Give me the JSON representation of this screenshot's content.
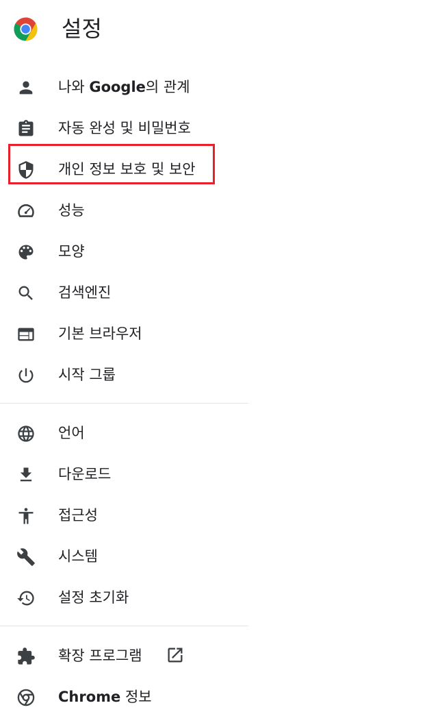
{
  "header": {
    "title": "설정",
    "logo_icon": "chrome-logo-icon"
  },
  "menu": {
    "group1": [
      {
        "id": "you-and-google",
        "icon": "person-icon",
        "label_prefix": "나와 ",
        "label_bold": "Google",
        "label_suffix": "의 관계"
      },
      {
        "id": "autofill",
        "icon": "clipboard-icon",
        "label": "자동 완성 및 비밀번호"
      },
      {
        "id": "privacy",
        "icon": "shield-icon",
        "label": "개인 정보 보호 및 보안",
        "highlighted": true
      },
      {
        "id": "performance",
        "icon": "speedometer-icon",
        "label": "성능"
      },
      {
        "id": "appearance",
        "icon": "palette-icon",
        "label": "모양"
      },
      {
        "id": "search-engine",
        "icon": "search-icon",
        "label": "검색엔진"
      },
      {
        "id": "default-browser",
        "icon": "browser-window-icon",
        "label": "기본 브라우저"
      },
      {
        "id": "on-startup",
        "icon": "power-icon",
        "label": "시작 그룹"
      }
    ],
    "group2": [
      {
        "id": "languages",
        "icon": "globe-icon",
        "label": "언어"
      },
      {
        "id": "downloads",
        "icon": "download-icon",
        "label": "다운로드"
      },
      {
        "id": "accessibility",
        "icon": "accessibility-icon",
        "label": "접근성"
      },
      {
        "id": "system",
        "icon": "wrench-icon",
        "label": "시스템"
      },
      {
        "id": "reset",
        "icon": "history-icon",
        "label": "설정 초기화"
      }
    ],
    "group3": [
      {
        "id": "extensions",
        "icon": "puzzle-icon",
        "label": "확장 프로그램",
        "trailing_icon": "open-in-new-icon"
      },
      {
        "id": "about",
        "icon": "chrome-icon",
        "label_bold": "Chrome",
        "label_suffix": " 정보"
      }
    ]
  },
  "colors": {
    "icon": "#3c4043",
    "text": "#202124",
    "highlight_border": "#e8202a",
    "divider": "#e3e3e3"
  }
}
